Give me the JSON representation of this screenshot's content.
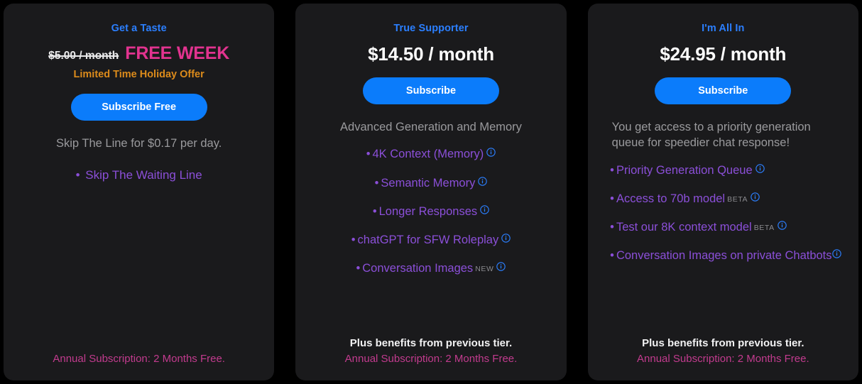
{
  "colors": {
    "page_background": "#000000",
    "card_background": "#1a1a1c",
    "plan_name": "#2b7fff",
    "button": "#0b7cfb",
    "feature_purple": "#8b4fd8",
    "promo_pink": "#e2338f",
    "promo_orange": "#dc8b1b",
    "annual_pink": "#c23b8e",
    "tagline_gray": "#9a9a9d",
    "info_icon_blue": "#2b7fff"
  },
  "plans": [
    {
      "name": "Get a Taste",
      "price_struck": "$5.00 / month",
      "price_promo": "FREE WEEK",
      "promo_note": "Limited Time Holiday Offer",
      "button_label": "Subscribe Free",
      "tagline": "Skip The Line for $0.17 per day.",
      "features": [
        {
          "label": "Skip The Waiting Line",
          "badge": "",
          "info": false
        }
      ],
      "footer_plus": "",
      "footer_annual": "Annual Subscription: 2 Months Free."
    },
    {
      "name": "True Supporter",
      "price": "$14.50 / month",
      "button_label": "Subscribe",
      "tagline": "Advanced Generation and Memory",
      "features": [
        {
          "label": "4K Context (Memory)",
          "badge": "",
          "info": true
        },
        {
          "label": "Semantic Memory",
          "badge": "",
          "info": true
        },
        {
          "label": "Longer Responses",
          "badge": "",
          "info": true
        },
        {
          "label": "chatGPT for SFW Roleplay",
          "badge": "",
          "info": true
        },
        {
          "label": "Conversation Images",
          "badge": "NEW",
          "info": true
        }
      ],
      "footer_plus": "Plus benefits from previous tier.",
      "footer_annual": "Annual Subscription: 2 Months Free."
    },
    {
      "name": "I'm All In",
      "price": "$24.95 / month",
      "button_label": "Subscribe",
      "tagline": "You get access to a priority generation queue for speedier chat response!",
      "features": [
        {
          "label": "Priority Generation Queue",
          "badge": "",
          "info": true
        },
        {
          "label": "Access to 70b model",
          "badge": "BETA",
          "info": true
        },
        {
          "label": "Test our 8K context model",
          "badge": "BETA",
          "info": true
        },
        {
          "label": "Conversation Images on private Chatbots",
          "badge": "",
          "info": true
        }
      ],
      "footer_plus": "Plus benefits from previous tier.",
      "footer_annual": "Annual Subscription: 2 Months Free."
    }
  ],
  "icons": {
    "info": "info-circle-icon",
    "bullet": "•"
  }
}
